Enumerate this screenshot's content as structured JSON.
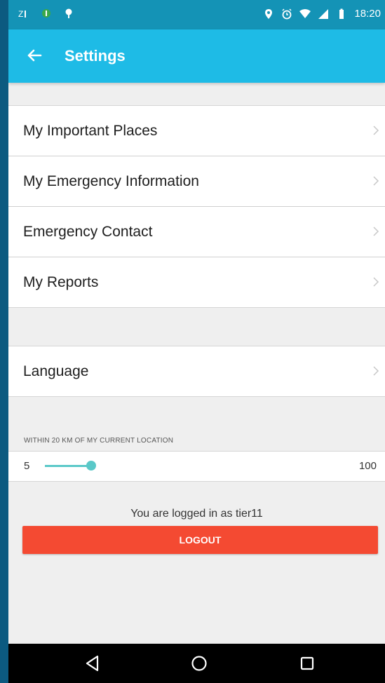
{
  "status_bar": {
    "time": "18:20",
    "left_icons": [
      "sim-icon",
      "notification-dot-icon",
      "location-pin-icon"
    ],
    "right_icons": [
      "location-icon",
      "alarm-icon",
      "wifi-icon",
      "signal-icon",
      "battery-icon"
    ]
  },
  "app_bar": {
    "title": "Settings",
    "background": "#1ebbe6"
  },
  "settings": {
    "group1": [
      {
        "label": "My Important Places"
      },
      {
        "label": "My Emergency Information"
      },
      {
        "label": "Emergency Contact"
      },
      {
        "label": "My Reports"
      }
    ],
    "group2": [
      {
        "label": "Language"
      }
    ]
  },
  "radius": {
    "caption": "WITHIN 20 KM OF MY CURRENT LOCATION",
    "min": "5",
    "max": "100",
    "value": 20,
    "range": [
      5,
      100
    ]
  },
  "account": {
    "logged_in_text": "You are logged in as tier11",
    "logout_label": "LOGOUT",
    "logout_color": "#f44a32"
  },
  "nav_bar": {
    "buttons": [
      "back-triangle-icon",
      "home-circle-icon",
      "recents-square-icon"
    ]
  }
}
